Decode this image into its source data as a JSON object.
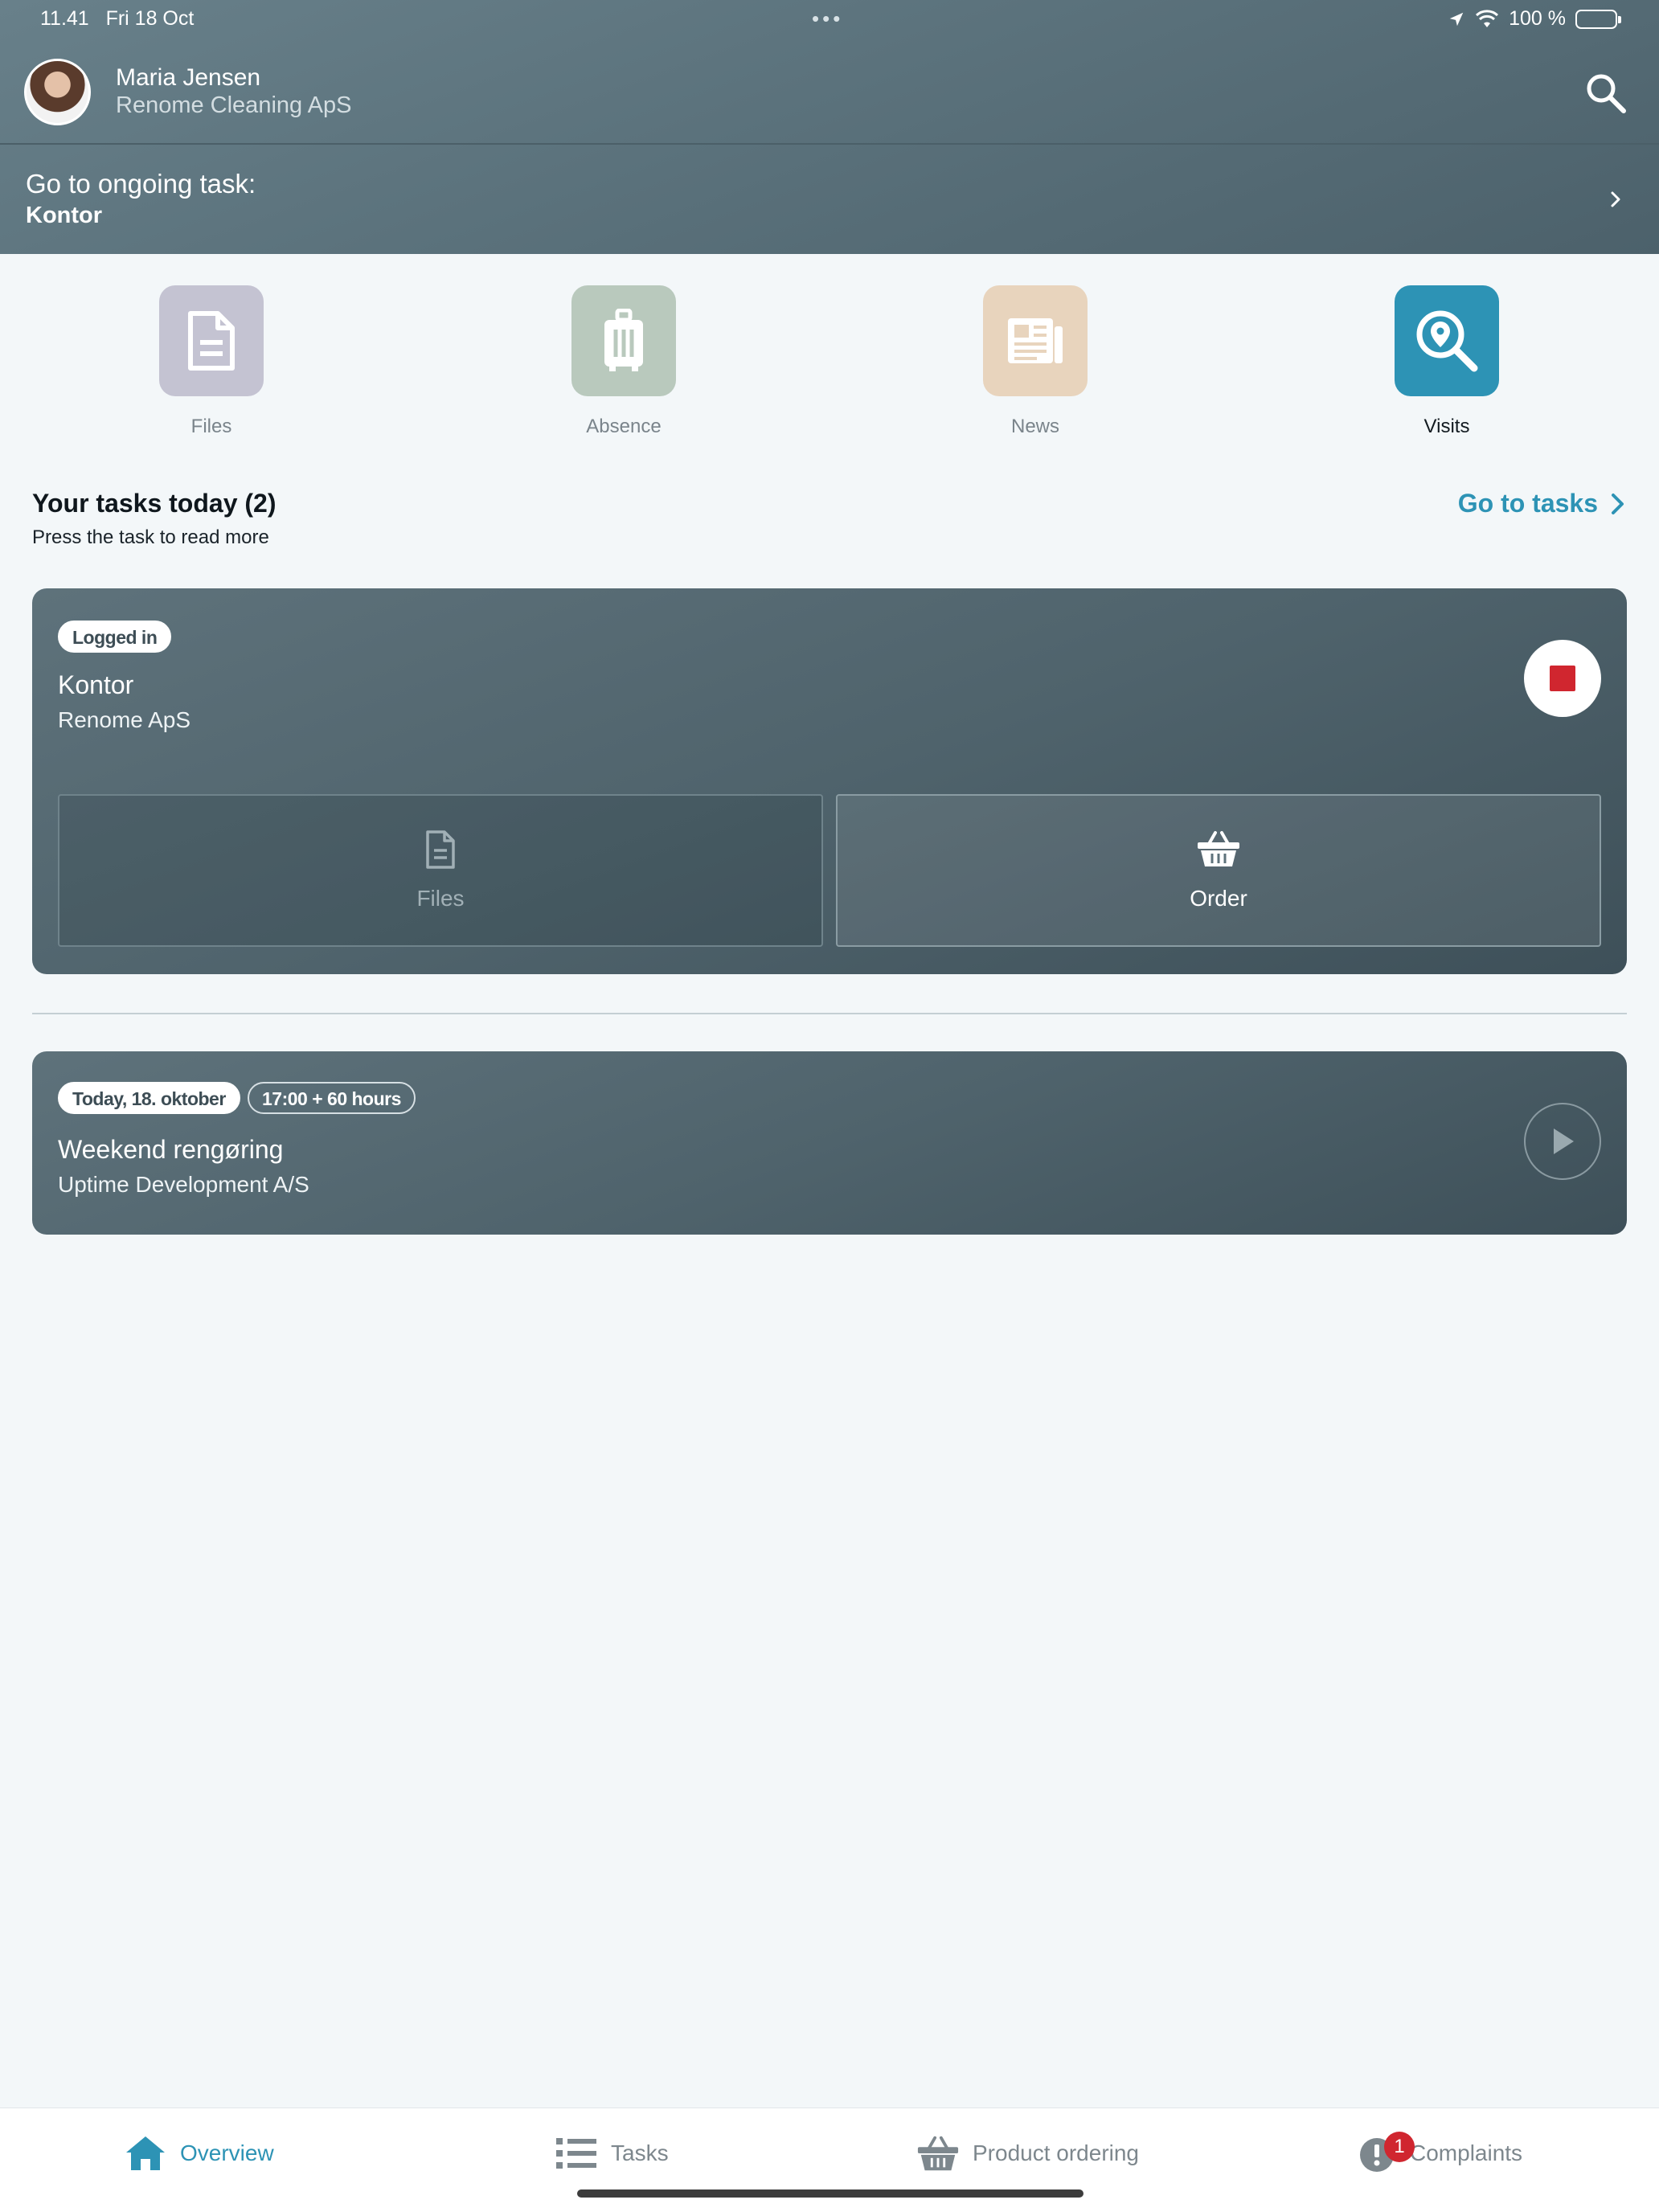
{
  "status_bar": {
    "time": "11.41",
    "date": "Fri 18 Oct",
    "dots": "•••",
    "battery": "100 %"
  },
  "header": {
    "user_name": "Maria Jensen",
    "company": "Renome Cleaning ApS",
    "ongoing_label": "Go to ongoing task:",
    "ongoing_task": "Kontor"
  },
  "tiles": [
    {
      "label": "Files",
      "icon": "file-icon",
      "color": "#c4c3d2"
    },
    {
      "label": "Absence",
      "icon": "luggage-icon",
      "color": "#b9c9bd"
    },
    {
      "label": "News",
      "icon": "newspaper-icon",
      "color": "#e8d4bd"
    },
    {
      "label": "Visits",
      "icon": "location-search-icon",
      "color": "#2d93b5"
    }
  ],
  "tasks_section": {
    "title": "Your tasks today (2)",
    "subtitle": "Press the task to read more",
    "go_to_tasks": "Go to tasks"
  },
  "task_cards": [
    {
      "pills": [
        "Logged in"
      ],
      "title": "Kontor",
      "company": "Renome ApS",
      "state": "active",
      "actions": [
        {
          "label": "Files",
          "icon": "file-icon"
        },
        {
          "label": "Order",
          "icon": "basket-icon"
        }
      ]
    },
    {
      "pills": [
        "Today, 18. oktober",
        "17:00 + 60 hours"
      ],
      "title": "Weekend rengøring",
      "company": "Uptime Development A/S",
      "state": "scheduled"
    }
  ],
  "bottom_nav": [
    {
      "label": "Overview",
      "icon": "home-icon",
      "active": true
    },
    {
      "label": "Tasks",
      "icon": "list-icon",
      "active": false
    },
    {
      "label": "Product ordering",
      "icon": "basket-icon",
      "active": false
    },
    {
      "label": "Complaints",
      "icon": "alert-icon",
      "active": false,
      "badge": "1"
    }
  ],
  "colors": {
    "accent": "#2d93b5",
    "stop_red": "#d0262f",
    "header_bg": "#5b727c",
    "card_bg": "#4f636c"
  }
}
